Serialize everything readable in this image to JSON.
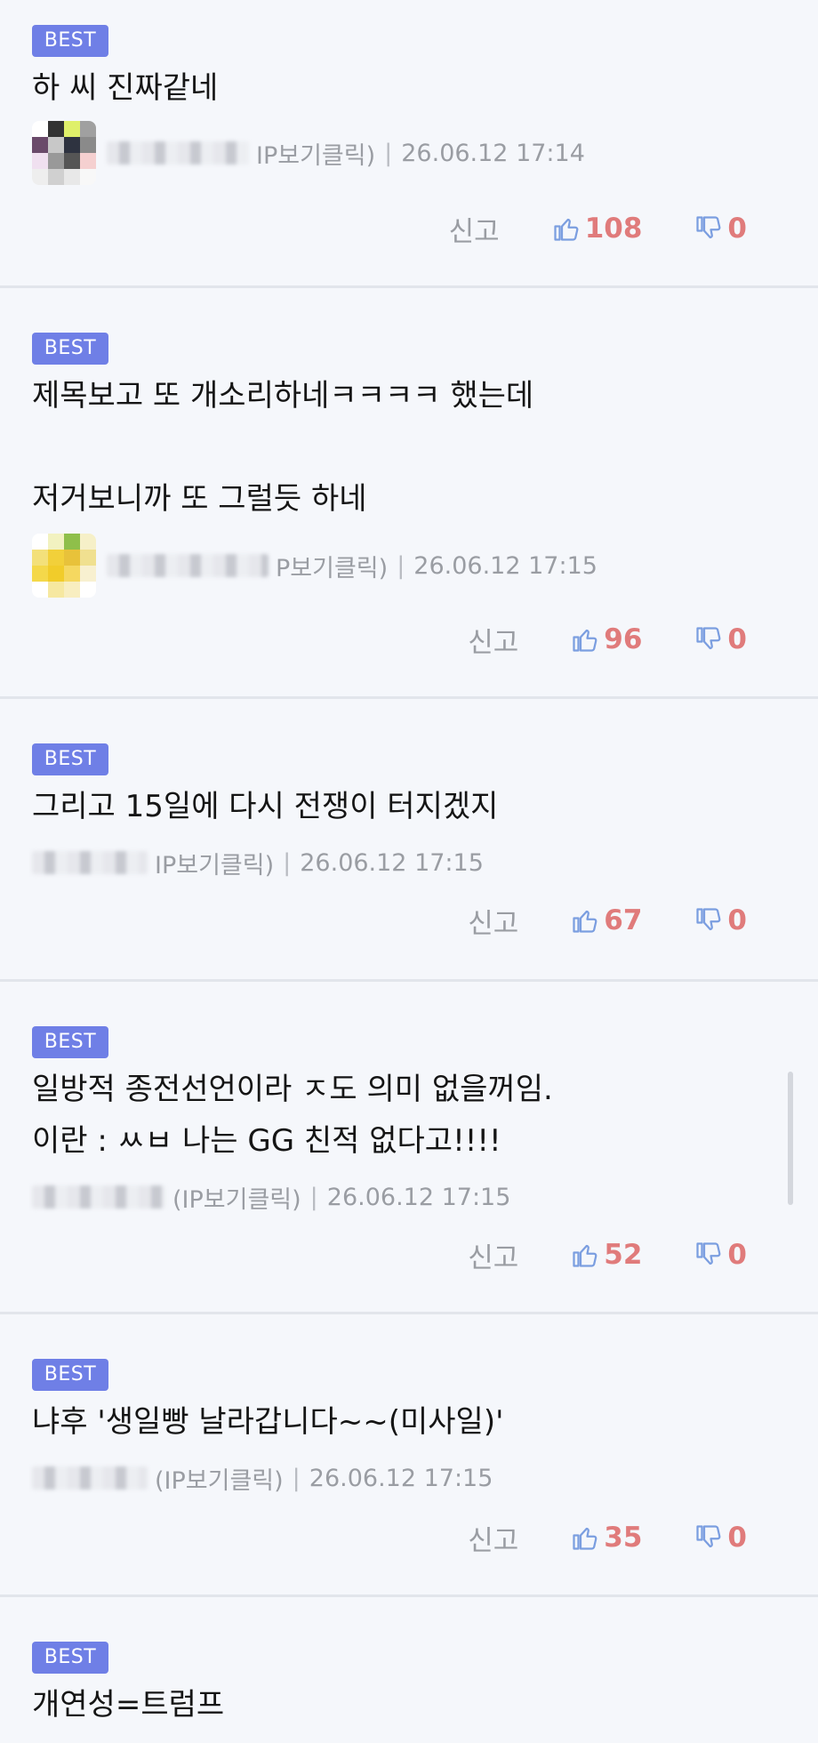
{
  "comments": [
    {
      "badge": "BEST",
      "text": "하 씨 진짜같네",
      "ip_label": "IP보기클릭)",
      "date": "26.06.12 17:14",
      "report": "신고",
      "likes": "108",
      "dislikes": "0",
      "avatar_colors": [
        "#ffffff",
        "#333333",
        "#dff06a",
        "#a0a0a0",
        "#6a4a6a",
        "#c8c8c8",
        "#2e3340",
        "#8a8a8a",
        "#f0e0f0",
        "#999999",
        "#555555",
        "#f5d0d0",
        "#eeeeee",
        "#d0d0d0",
        "#e8e8e8",
        "#f8f8f8"
      ]
    },
    {
      "badge": "BEST",
      "text": "제목보고 또 개소리하네ㅋㅋㅋㅋ 했는데\n\n저거보니까 또 그럴듯 하네",
      "ip_label": "P보기클릭)",
      "date": "26.06.12 17:15",
      "report": "신고",
      "likes": "96",
      "dislikes": "0",
      "avatar_colors": [
        "#ffffff",
        "#f2f2c0",
        "#8fbf4a",
        "#f6f0c8",
        "#f3e07a",
        "#f2d03a",
        "#e8c23a",
        "#f0e090",
        "#f4d84a",
        "#f1cc2a",
        "#f5d860",
        "#f8f0d0",
        "#ffffff",
        "#f6e8a0",
        "#f8eec0",
        "#ffffff"
      ]
    },
    {
      "badge": "BEST",
      "text": "그리고 15일에 다시 전쟁이 터지겠지",
      "ip_label": "IP보기클릭)",
      "date": "26.06.12 17:15",
      "report": "신고",
      "likes": "67",
      "dislikes": "0"
    },
    {
      "badge": "BEST",
      "text": "일방적 종전선언이라 ㅈ도 의미 없을꺼임.\n이란 : ㅆㅂ 나는 GG 친적 없다고!!!!",
      "ip_label": "(IP보기클릭)",
      "date": "26.06.12 17:15",
      "report": "신고",
      "likes": "52",
      "dislikes": "0"
    },
    {
      "badge": "BEST",
      "text": "냐후 '생일빵 날라갑니다~~(미사일)'",
      "ip_label": "(IP보기클릭)",
      "date": "26.06.12 17:15",
      "report": "신고",
      "likes": "35",
      "dislikes": "0"
    },
    {
      "badge": "BEST",
      "text": "개연성=트럼프"
    }
  ],
  "colors": {
    "accent": "#6f7fe6",
    "thumb_up": "#7b9ee0",
    "counts": "#e07b7b",
    "dislike_icon": "#7b9ee0"
  }
}
